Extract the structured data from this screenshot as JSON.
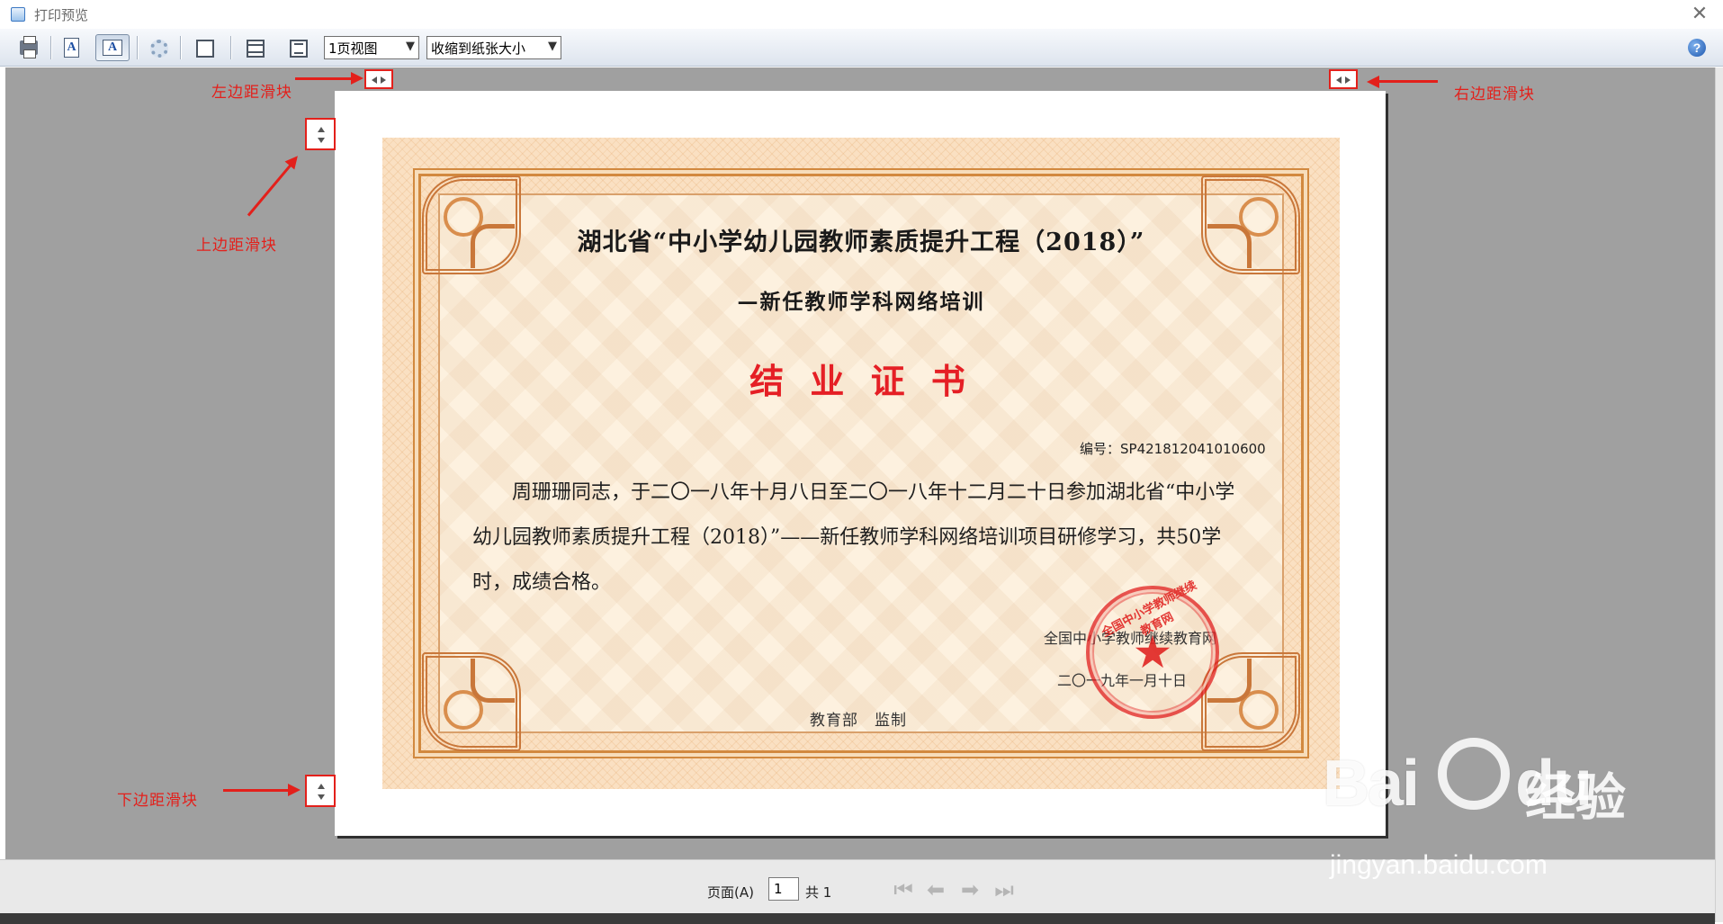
{
  "window": {
    "title": "打印预览",
    "close_glyph": "✕"
  },
  "toolbar": {
    "page_view_select": "1页视图",
    "zoom_select": "收缩到纸张大小",
    "page_icon_letter": "A",
    "help_glyph": "?"
  },
  "certificate": {
    "title": "湖北省“中小学幼儿园教师素质提升工程（2018）”",
    "subtitle": "—新任教师学科网络培训",
    "heading": "结 业 证 书",
    "number": "编号：SP421812041010600",
    "body": "周珊珊同志，于二〇一八年十月八日至二〇一八年十二月二十日参加湖北省“中小学幼儿园教师素质提升工程（2018）”——新任教师学科网络培训项目研修学习，共50学时，成绩合格。",
    "issuer": "全国中小学教师继续教育网",
    "date": "二〇一九年一月十日",
    "supervisor": "教育部　监制",
    "seal_text": "全国中小学教师继续教育网",
    "seal_star": "★"
  },
  "annotations": {
    "left_margin": "左边距滑块",
    "right_margin": "右边距滑块",
    "top_margin": "上边距滑块",
    "bottom_margin": "下边距滑块"
  },
  "navigation": {
    "page_label": "页面(A)",
    "page_value": "1",
    "total_label": "共 1",
    "first_glyph": "⏮",
    "prev_glyph": "⬅",
    "next_glyph": "➡",
    "last_glyph": "⏭"
  },
  "watermark": {
    "logo": "Bai",
    "logo_suffix": "du",
    "chinese": "经验",
    "url": "jingyan.baidu.com"
  },
  "colors": {
    "annotation_red": "#e3201b",
    "seal_red": "#e0201e",
    "heading_red": "#e51f25",
    "frame_orange": "#d2893f",
    "preview_gray": "#a0a0a0"
  }
}
